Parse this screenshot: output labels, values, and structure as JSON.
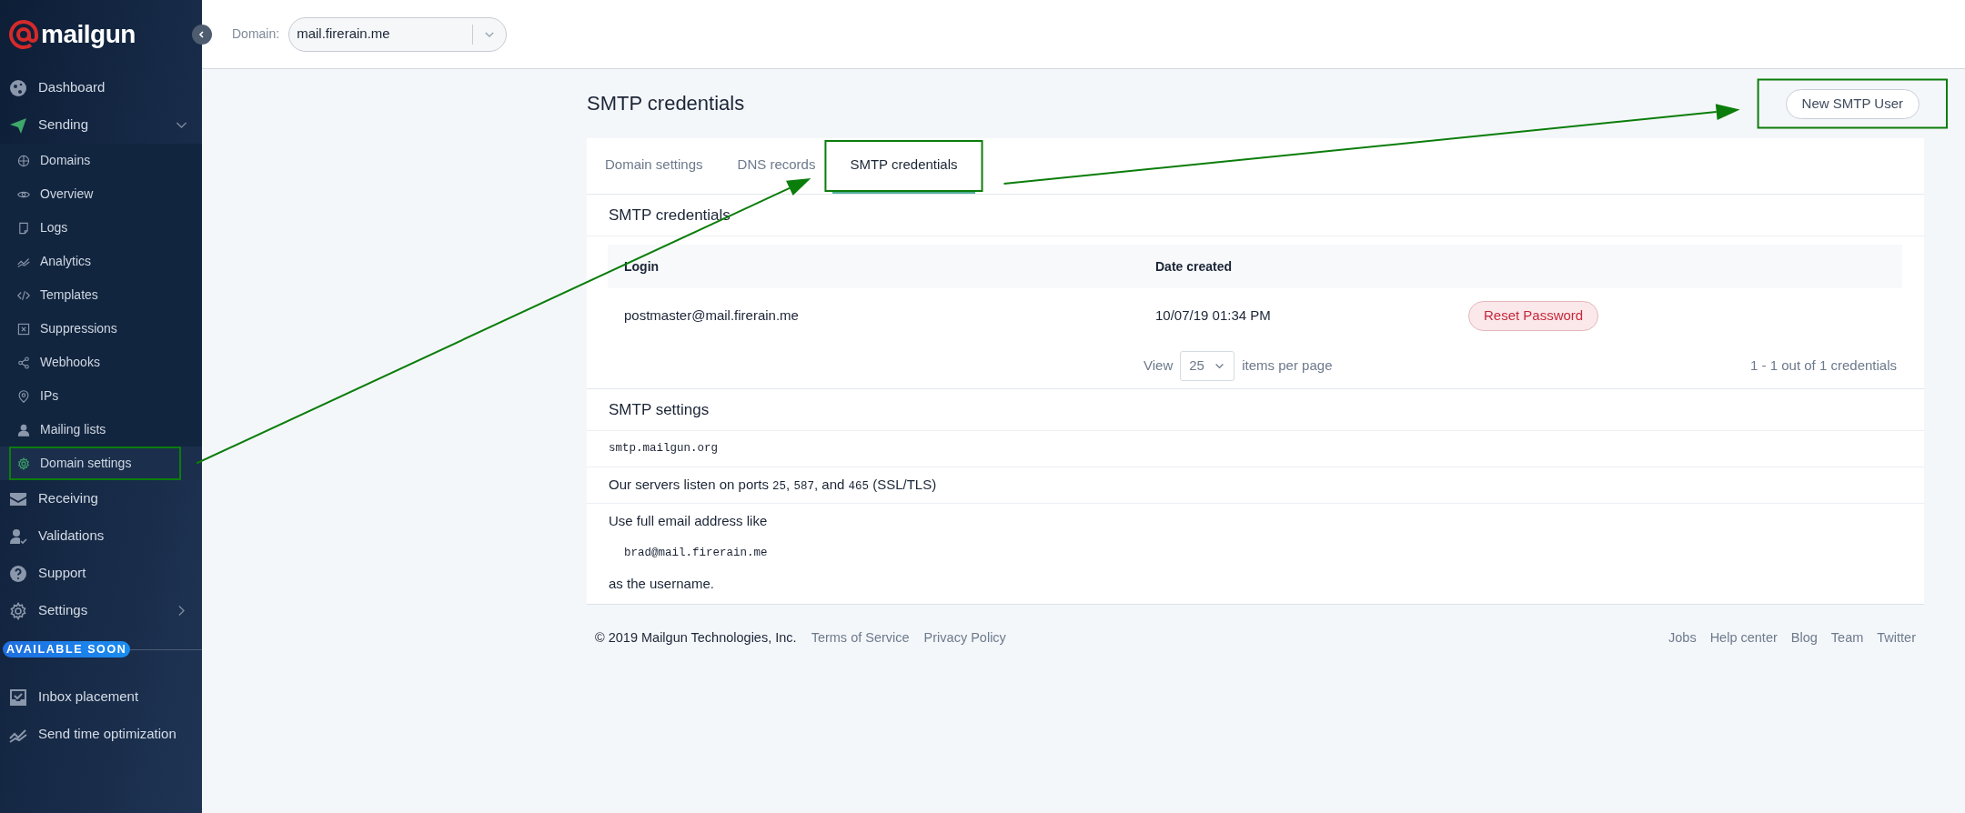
{
  "sidebar": {
    "logo": "mailgun",
    "items": [
      {
        "label": "Dashboard",
        "kind": "link"
      },
      {
        "label": "Sending",
        "kind": "group",
        "expanded": true,
        "children": [
          {
            "label": "Domains",
            "selected": false
          },
          {
            "label": "Overview",
            "selected": false
          },
          {
            "label": "Logs",
            "selected": false
          },
          {
            "label": "Analytics",
            "selected": false
          },
          {
            "label": "Templates",
            "selected": false
          },
          {
            "label": "Suppressions",
            "selected": false
          },
          {
            "label": "Webhooks",
            "selected": false
          },
          {
            "label": "IPs",
            "selected": false
          },
          {
            "label": "Mailing lists",
            "selected": false
          },
          {
            "label": "Domain settings",
            "selected": true
          }
        ]
      },
      {
        "label": "Receiving",
        "kind": "link"
      },
      {
        "label": "Validations",
        "kind": "link"
      },
      {
        "label": "Support",
        "kind": "link"
      },
      {
        "label": "Settings",
        "kind": "group",
        "expanded": false
      }
    ],
    "section": {
      "badge": "AVAILABLE SOON",
      "items": [
        {
          "label": "Inbox placement"
        },
        {
          "label": "Send time optimization"
        }
      ]
    }
  },
  "domain_picker": {
    "label": "Domain:",
    "value": "mail.firerain.me"
  },
  "page": {
    "title": "SMTP credentials",
    "button": "New SMTP User"
  },
  "tabs": [
    {
      "label": "Domain settings",
      "selected": false
    },
    {
      "label": "DNS records",
      "selected": false
    },
    {
      "label": "SMTP credentials",
      "selected": true
    }
  ],
  "credentials": {
    "heading": "SMTP credentials",
    "columns": [
      "Login",
      "Date created"
    ],
    "rows": [
      {
        "login": "postmaster@mail.firerain.me",
        "date": "10/07/19 01:34 PM",
        "action": "Reset Password"
      }
    ],
    "pagination": {
      "view_label": "View",
      "per_page": "25",
      "suffix": "items per page",
      "summary": "1 - 1 out of 1 credentials"
    }
  },
  "smtp_settings": {
    "heading": "SMTP settings",
    "rows": [
      {
        "kind": "code",
        "text": "smtp.mailgun.org"
      },
      {
        "kind": "mixed",
        "parts": [
          {
            "kind": "text",
            "text": "Our servers listen on ports "
          },
          {
            "kind": "code",
            "text": "25"
          },
          {
            "kind": "text",
            "text": ", "
          },
          {
            "kind": "code",
            "text": "587"
          },
          {
            "kind": "text",
            "text": ", and "
          },
          {
            "kind": "code",
            "text": "465"
          },
          {
            "kind": "text",
            "text": " (SSL/TLS)"
          }
        ]
      },
      {
        "kind": "example",
        "intro": "Use full email address like",
        "example": "brad@mail.firerain.me",
        "outro": "as the username."
      }
    ]
  },
  "footer": {
    "copyright": "© 2019 Mailgun Technologies, Inc.",
    "left_links": [
      "Terms of Service",
      "Privacy Policy"
    ],
    "right_links": [
      "Jobs",
      "Help center",
      "Blog",
      "Team",
      "Twitter"
    ]
  }
}
